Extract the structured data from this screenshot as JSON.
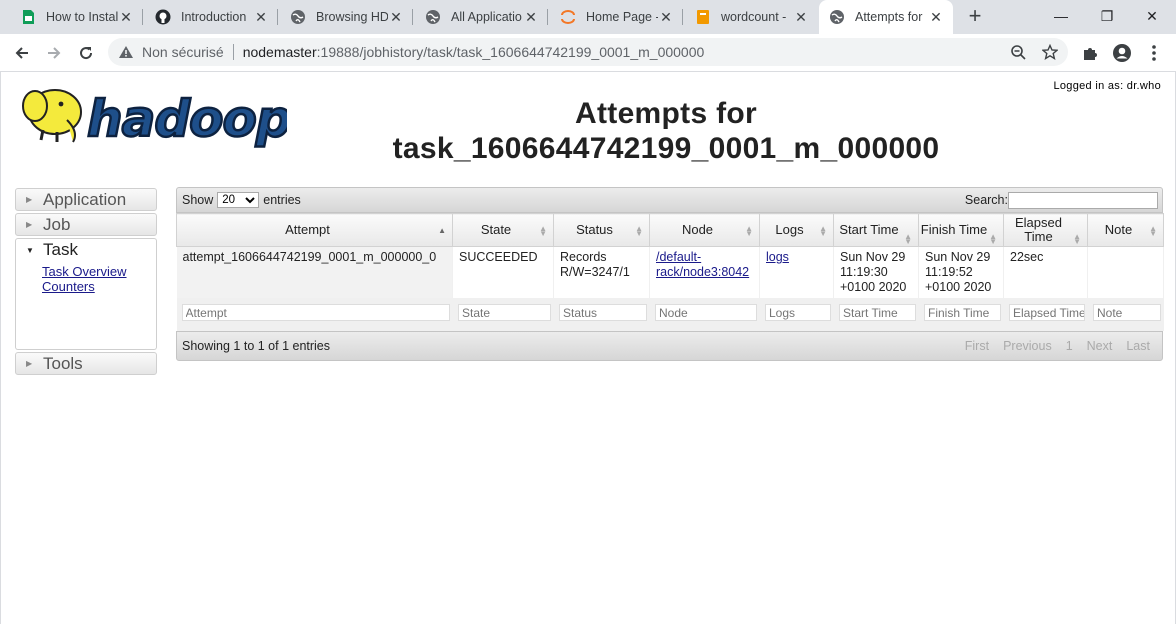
{
  "browser": {
    "tabs": [
      {
        "title": "How to Instal",
        "icon": "sheets-icon"
      },
      {
        "title": "Introduction",
        "icon": "github-icon"
      },
      {
        "title": "Browsing HDI",
        "icon": "globe-icon"
      },
      {
        "title": "All Applicatio",
        "icon": "globe-icon"
      },
      {
        "title": "Home Page -",
        "icon": "jupyter-icon"
      },
      {
        "title": "wordcount -",
        "icon": "notebook-icon"
      },
      {
        "title": "Attempts for",
        "icon": "globe-icon",
        "active": true
      }
    ],
    "security_label": "Non sécurisé",
    "url_host": "nodemaster",
    "url_path": ":19888/jobhistory/task/task_1606644742199_0001_m_000000"
  },
  "page": {
    "logged_in": "Logged in as: dr.who",
    "title_line1": "Attempts for",
    "title_line2": "task_1606644742199_0001_m_000000",
    "logo_alt": "hadoop"
  },
  "sidebar": {
    "sections": [
      {
        "label": "Application",
        "open": false
      },
      {
        "label": "Job",
        "open": false
      },
      {
        "label": "Task",
        "open": true,
        "links": [
          "Task Overview",
          "Counters"
        ]
      },
      {
        "label": "Tools",
        "open": false
      }
    ]
  },
  "table": {
    "show_label": "Show",
    "entries_value": "20",
    "entries_label": "entries",
    "search_label": "Search:",
    "columns": [
      "Attempt",
      "State",
      "Status",
      "Node",
      "Logs",
      "Start Time",
      "Finish Time",
      "Elapsed Time",
      "Note"
    ],
    "rows": [
      {
        "attempt": "attempt_1606644742199_0001_m_000000_0",
        "state": "SUCCEEDED",
        "status": "Records R/W=3247/1",
        "node": "/default-rack/node3:8042",
        "logs": "logs",
        "start_time": "Sun Nov 29 11:19:30 +0100 2020",
        "finish_time": "Sun Nov 29 11:19:52 +0100 2020",
        "elapsed": "22sec",
        "note": ""
      }
    ],
    "filters": [
      "Attempt",
      "State",
      "Status",
      "Node",
      "Logs",
      "Start Time",
      "Finish Time",
      "Elapsed Time",
      "Note"
    ],
    "info": "Showing 1 to 1 of 1 entries",
    "pager": {
      "first": "First",
      "previous": "Previous",
      "page": "1",
      "next": "Next",
      "last": "Last"
    }
  }
}
